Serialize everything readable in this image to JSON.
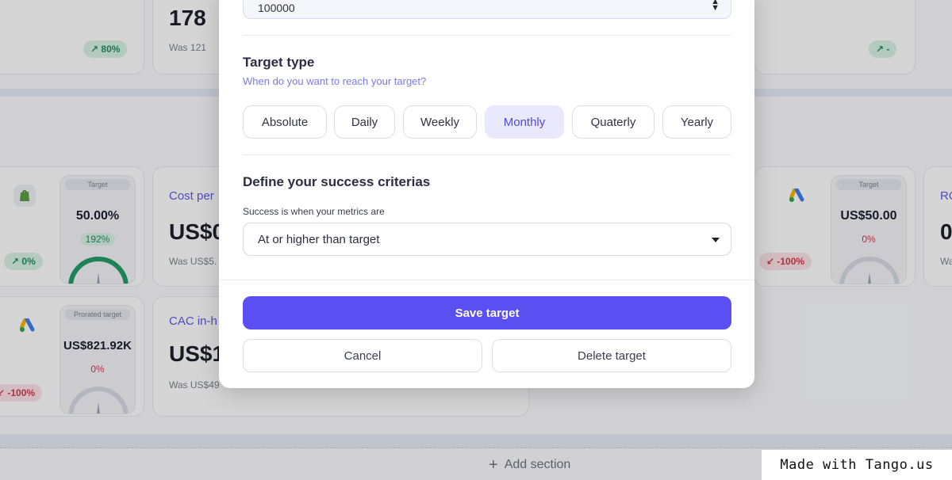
{
  "background": {
    "top_cards": [
      {
        "pill": "↗ 80%",
        "pill_type": "up"
      },
      {
        "value": "178",
        "was": "Was 121"
      },
      {
        "pill": "↗ -",
        "pill_type": "up"
      }
    ],
    "row1": {
      "left_pill": "↗ 0%",
      "mini_left": {
        "tag": "Target",
        "value": "50.00%",
        "pct": "192%"
      },
      "metric_title": "Cost per",
      "metric_value": "US$0",
      "metric_was": "Was US$5.",
      "right_pill": "↙ -100%",
      "mini_right": {
        "tag": "Target",
        "value": "US$50.00",
        "pct": "0%"
      },
      "far_right_title": "RO",
      "far_right_value": "0",
      "far_right_was": "Wa"
    },
    "row2": {
      "left_pill": "↙ -100%",
      "mini_left": {
        "tag": "Prorated target",
        "value": "US$821.92K",
        "pct": "0%"
      },
      "metric_title": "CAC in-h",
      "metric_value": "US$1",
      "metric_was": "Was US$49"
    },
    "add_section": "Add section"
  },
  "modal": {
    "top_field_value": "100000",
    "target_type": {
      "title": "Target type",
      "subtitle": "When do you want to reach your target?",
      "options": [
        "Absolute",
        "Daily",
        "Weekly",
        "Monthly",
        "Quaterly",
        "Yearly"
      ],
      "selected": "Monthly"
    },
    "criteria": {
      "title": "Define your success criterias",
      "label": "Success is when your metrics are",
      "selected": "At or higher than target"
    },
    "buttons": {
      "save": "Save target",
      "cancel": "Cancel",
      "delete": "Delete target"
    }
  },
  "watermark": "Made with Tango.us",
  "colors": {
    "primary": "#5a4ff0",
    "accent_text": "#7c7ae6",
    "selected_bg": "#e9e8fd",
    "positive": "#1a8f5c",
    "negative": "#d0364d"
  }
}
